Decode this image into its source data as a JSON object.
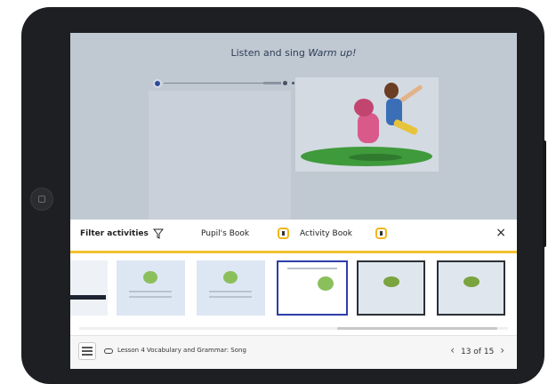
{
  "activity": {
    "title_prefix": "Listen and sing",
    "title_emphasis": "Warm up!"
  },
  "toolbar": {
    "filter_label": "Filter activities",
    "pupils_book": "Pupil's Book",
    "activity_book": "Activity Book",
    "close": "×"
  },
  "footer": {
    "lesson": "Lesson 4 Vocabulary and Grammar: Song",
    "page_current": "13",
    "page_sep": "of",
    "page_total": "15",
    "prev": "‹",
    "next": "›"
  },
  "icons": {
    "filter": "funnel-icon",
    "book": "book-icon",
    "menu": "menu-icon",
    "link": "link-icon"
  },
  "colors": {
    "accent_yellow": "#f2c12e",
    "selected_border": "#2d3ea8"
  }
}
